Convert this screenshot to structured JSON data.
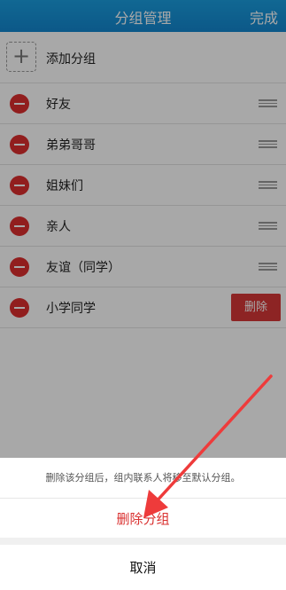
{
  "header": {
    "title": "分组管理",
    "done_label": "完成"
  },
  "add_group": {
    "label": "添加分组",
    "icon": "plus-icon"
  },
  "groups": [
    {
      "label": "好友"
    },
    {
      "label": "弟弟哥哥"
    },
    {
      "label": "姐妹们"
    },
    {
      "label": "亲人"
    },
    {
      "label": "友谊（同学）"
    },
    {
      "label": "小学同学",
      "delete_label": "删除"
    }
  ],
  "action_sheet": {
    "message": "删除该分组后，组内联系人将移至默认分组。",
    "confirm_label": "删除分组",
    "cancel_label": "取消"
  },
  "colors": {
    "header": "#1a9ee0",
    "danger": "#d63737",
    "confirm_text": "#d9302f",
    "arrow": "#ee3b3b"
  }
}
